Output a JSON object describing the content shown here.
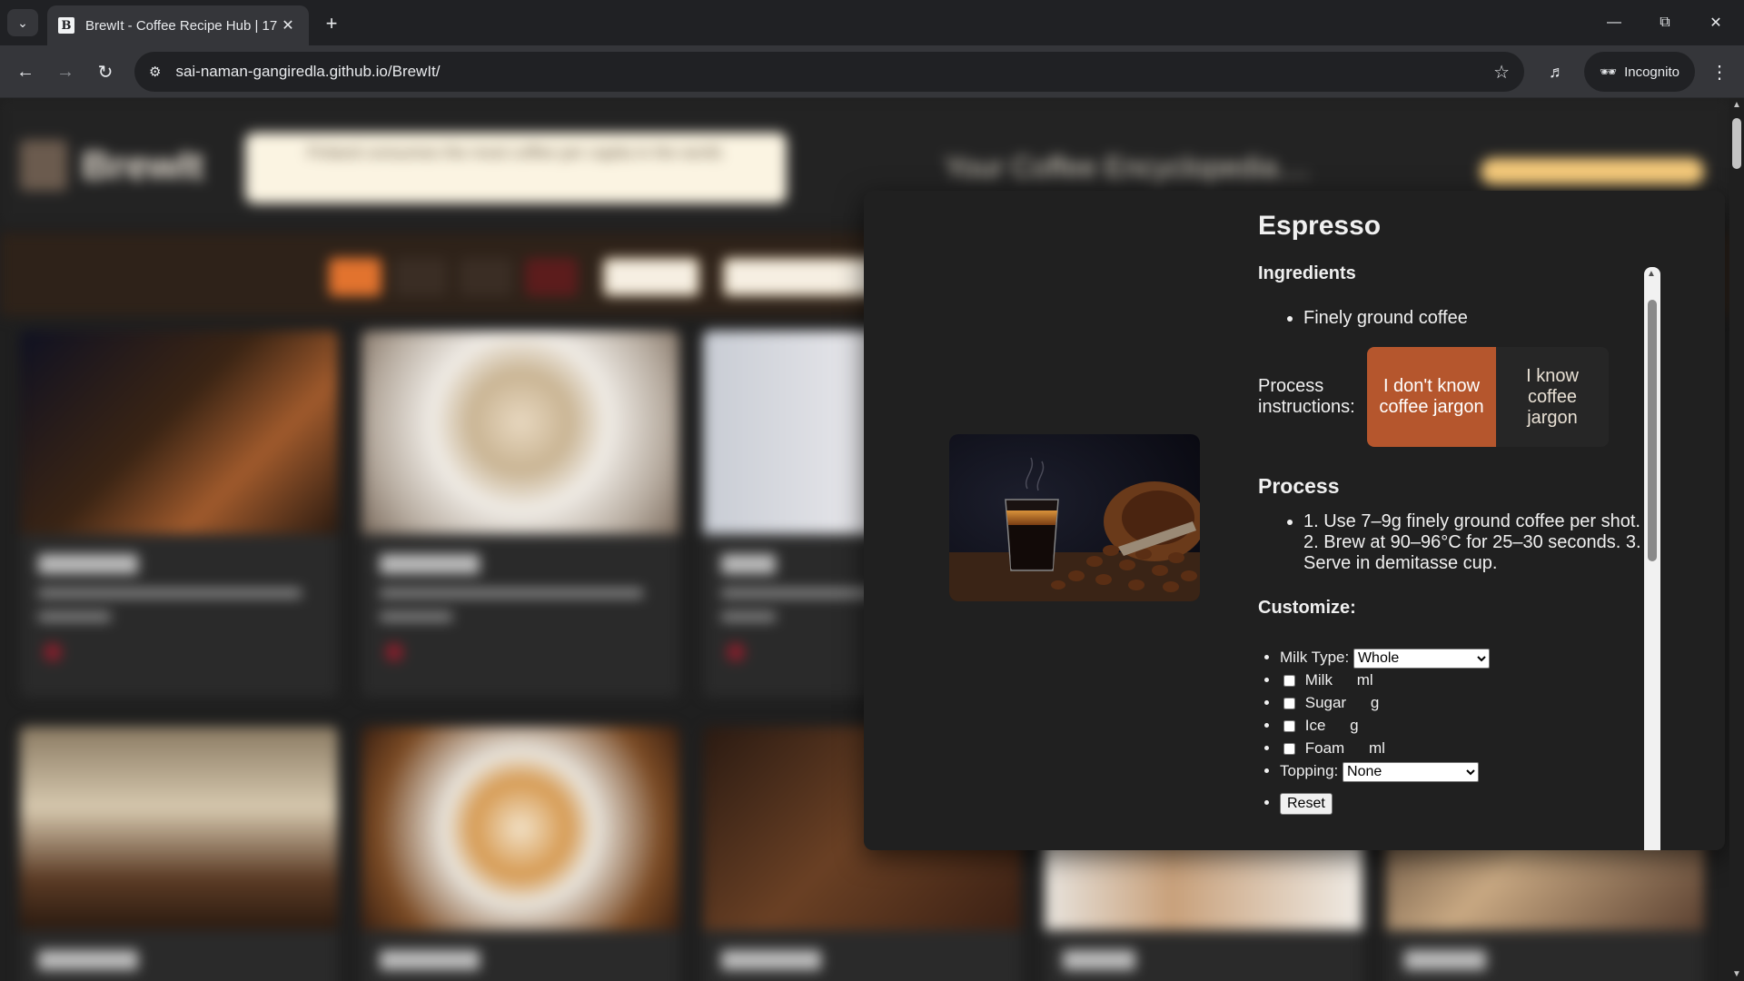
{
  "browser": {
    "tab_title": "BrewIt - Coffee Recipe Hub | 17",
    "tab_favicon": "B",
    "url": "sai-naman-gangiredla.github.io/BrewIt/",
    "incognito_label": "Incognito"
  },
  "site": {
    "logo": "BrewIt",
    "fact": "Finland consumes the most coffee per capita in the world.",
    "tagline": "Your Coffee Encyclopedia....",
    "cards_row1": [
      "Espresso",
      "Cappuccino",
      "Latte"
    ],
    "cards_row2": [
      "Macchiato",
      "Flat White",
      "Cold Brew",
      "Frappe",
      "Affogato"
    ]
  },
  "modal": {
    "title": "Espresso",
    "ingredients_heading": "Ingredients",
    "ingredients": [
      "Finely ground coffee"
    ],
    "process_instructions_label": "Process instructions:",
    "jargon_off_label": "I don't know coffee jargon",
    "jargon_on_label": "I know coffee jargon",
    "process_heading": "Process",
    "process_text": "1. Use 7–9g finely ground coffee per shot. 2. Brew at 90–96°C for 25–30 seconds. 3. Serve in demitasse cup.",
    "customize_heading": "Customize:",
    "milk_type_label": "Milk Type:",
    "milk_type_value": "Whole",
    "milk_label": "Milk",
    "milk_unit": "ml",
    "sugar_label": "Sugar",
    "sugar_unit": "g",
    "ice_label": "Ice",
    "ice_unit": "g",
    "foam_label": "Foam",
    "foam_unit": "ml",
    "topping_label": "Topping:",
    "topping_value": "None",
    "reset_label": "Reset"
  },
  "colors": {
    "accent": "#b5562d",
    "modal_bg": "#202020"
  }
}
